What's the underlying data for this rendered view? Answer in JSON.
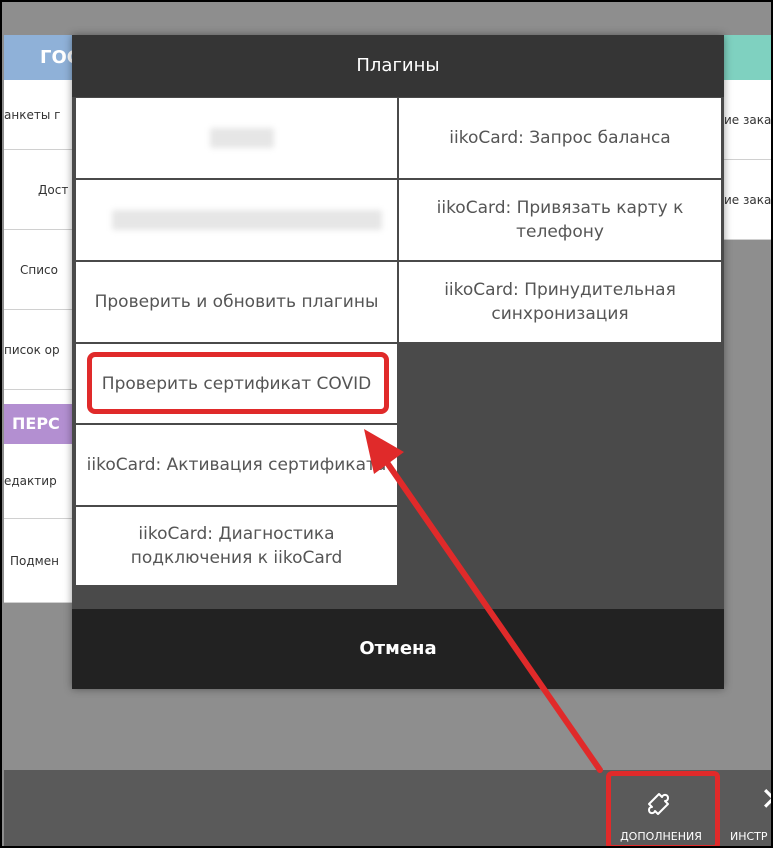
{
  "background": {
    "left_header": "ГОС",
    "left_items": [
      "анкеты г",
      "Дост",
      "Списо",
      "писок ор"
    ],
    "left_section_header": "ПЕРС",
    "left_section_items": [
      "едактир",
      "Подмен"
    ],
    "right_items": [
      "ие заказ",
      "ие заказ"
    ]
  },
  "modal": {
    "title": "Плагины",
    "plugins": {
      "check_update": "Проверить и обновить плагины",
      "covid": "Проверить сертификат COVID",
      "activation": "iikoCard: Активация сертификата",
      "diagnostics": "iikoCard: Диагностика подключения к iikoCard",
      "balance": "iikoCard: Запрос баланса",
      "bind_phone": "iikoCard: Привязать карту к телефону",
      "force_sync": "iikoCard: Принудительная синхронизация"
    },
    "cancel": "Отмена"
  },
  "bottom_bar": {
    "addons_label": "ДОПОЛНЕНИЯ",
    "addons_icon": "puzzle-icon",
    "tools_label": "ИНСТР",
    "tools_icon": "tools-icon"
  },
  "annotation_color": "#e02a2a"
}
